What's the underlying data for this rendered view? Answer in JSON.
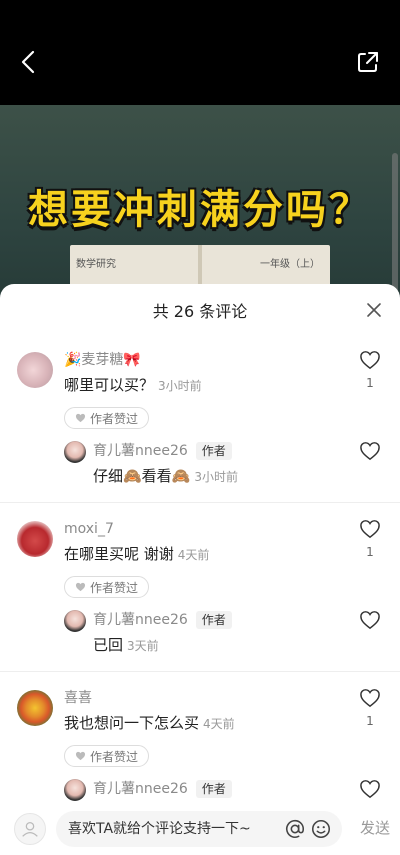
{
  "video": {
    "title": "想要冲刺满分吗？",
    "book_left": "数学研究",
    "book_right": "一年级（上）"
  },
  "sheet": {
    "title": "共 26 条评论",
    "comments": [
      {
        "name": "🎉麦芽糖🎀",
        "text": "哪里可以买？",
        "time": "3小时前",
        "likes": "1",
        "author_liked": "作者赞过",
        "reply": {
          "name": "育儿薯nnee26",
          "tag": "作者",
          "text": "仔细🙈看看🙈",
          "time": "3小时前"
        }
      },
      {
        "name": "moxi_7",
        "text": "在哪里买呢 谢谢",
        "time": "4天前",
        "likes": "1",
        "author_liked": "作者赞过",
        "reply": {
          "name": "育儿薯nnee26",
          "tag": "作者",
          "text": "已回",
          "time": "3天前"
        }
      },
      {
        "name": "喜喜",
        "text": "我也想问一下怎么买",
        "time": "4天前",
        "likes": "1",
        "author_liked": "作者赞过",
        "reply": {
          "name": "育儿薯nnee26",
          "tag": "作者"
        }
      }
    ]
  },
  "input": {
    "placeholder": "喜欢TA就给个评论支持一下~",
    "send_label": "发送"
  },
  "colors": {
    "title_yellow": "#f7d21e",
    "sheet_bg": "#ffffff",
    "muted": "#999999"
  }
}
